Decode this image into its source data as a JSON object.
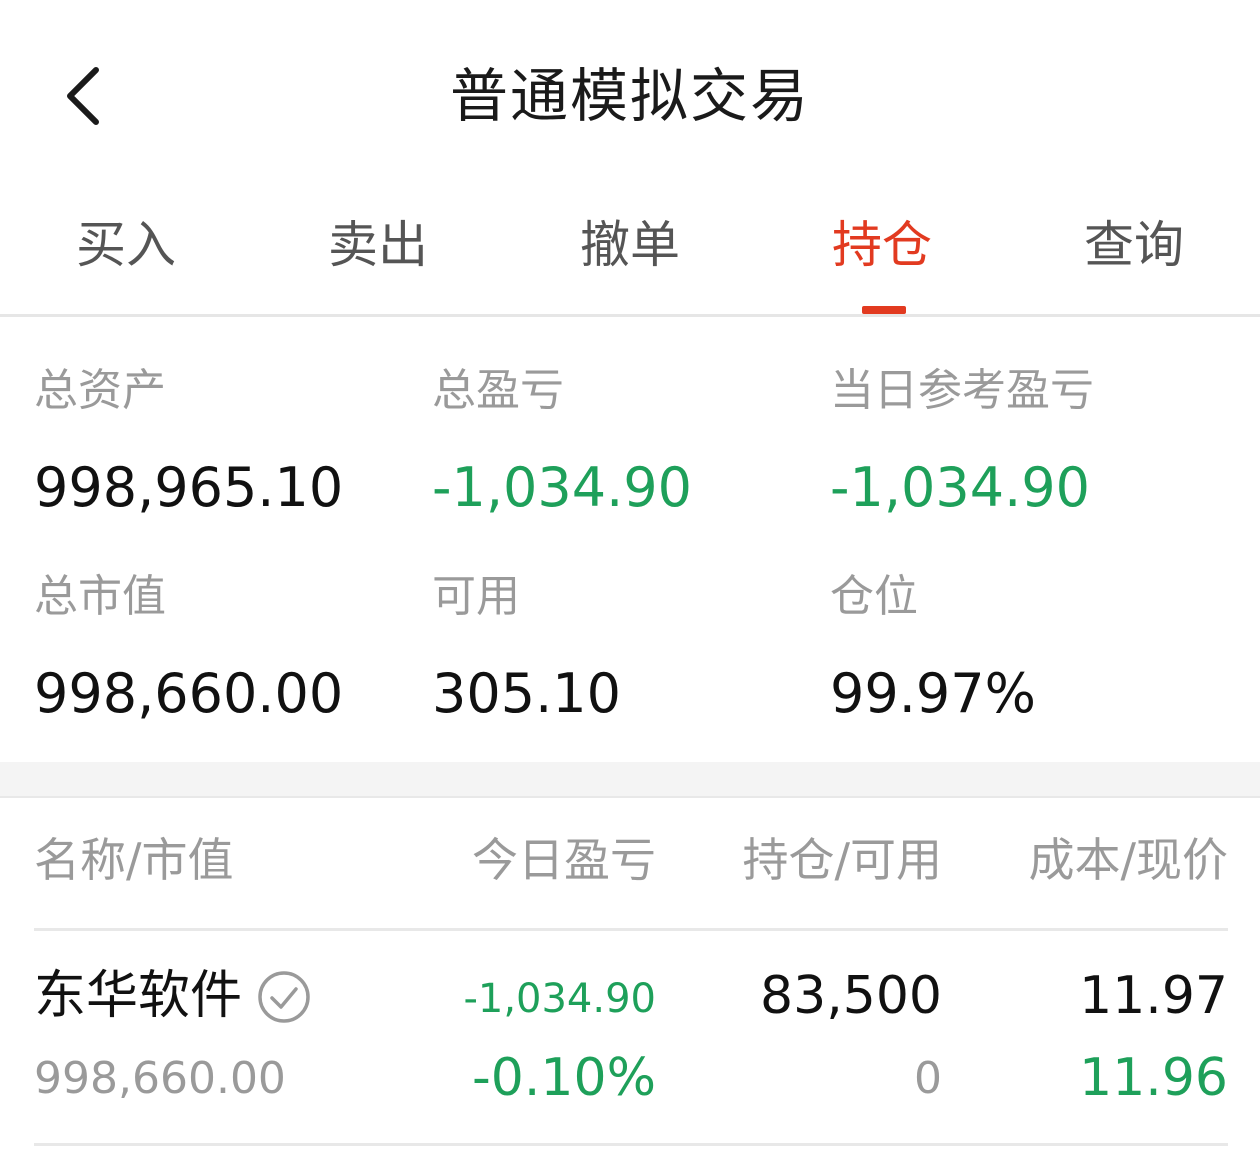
{
  "header": {
    "title": "普通模拟交易",
    "back_icon": "chevron-left-icon"
  },
  "tabs": [
    {
      "label": "买入",
      "active": false
    },
    {
      "label": "卖出",
      "active": false
    },
    {
      "label": "撤单",
      "active": false
    },
    {
      "label": "持仓",
      "active": true
    },
    {
      "label": "查询",
      "active": false
    }
  ],
  "summary": {
    "total_assets": {
      "label": "总资产",
      "value": "998,965.10"
    },
    "total_pl": {
      "label": "总盈亏",
      "value": "-1,034.90"
    },
    "daily_pl": {
      "label": "当日参考盈亏",
      "value": "-1,034.90"
    },
    "market_value": {
      "label": "总市值",
      "value": "998,660.00"
    },
    "available": {
      "label": "可用",
      "value": "305.10"
    },
    "position_ratio": {
      "label": "仓位",
      "value": "99.97%"
    }
  },
  "table": {
    "headers": {
      "name": "名称/市值",
      "today_pl": "今日盈亏",
      "position": "持仓/可用",
      "price": "成本/现价"
    },
    "rows": [
      {
        "name": "东华软件",
        "market_value": "998,660.00",
        "today_pl": "-1,034.90",
        "today_pl_pct": "-0.10%",
        "position": "83,500",
        "available": "0",
        "cost": "11.97",
        "current": "11.96",
        "badge_icon": "check-circle-icon"
      }
    ]
  },
  "colors": {
    "accent": "#e23a20",
    "loss": "#1ea05a",
    "label": "#9a9a9a",
    "text": "#111111"
  }
}
